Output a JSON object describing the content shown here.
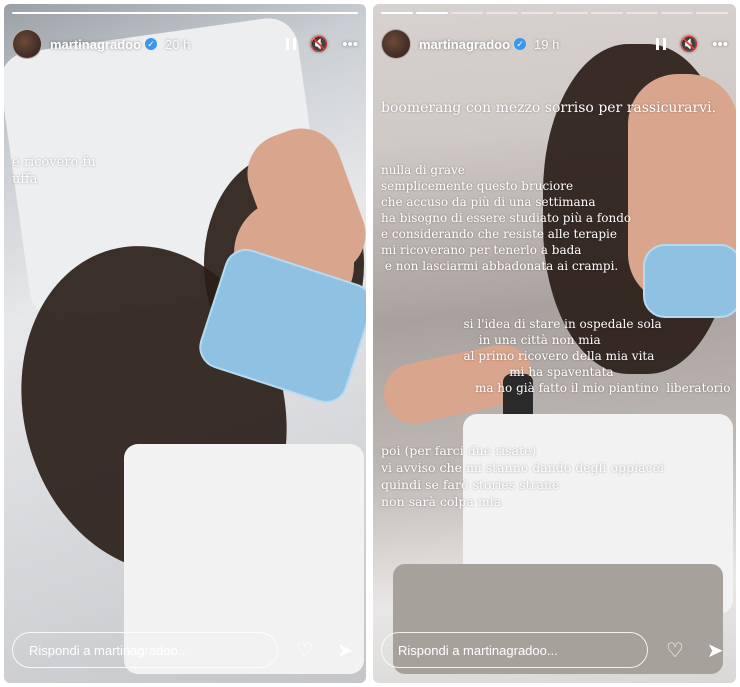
{
  "stories": [
    {
      "username": "martinagradoo",
      "time": "20 h",
      "progress_done": 1,
      "progress_total": 1,
      "caption": "e ricovero fu\nuffa",
      "reply_placeholder": "Rispondi a martinagradoo..."
    },
    {
      "username": "martinagradoo",
      "time": "19 h",
      "progress_done": 2,
      "progress_total": 10,
      "caption_title": "boomerang con mezzo sorriso per rassicurarvi.",
      "caption_block1": "nulla di grave\nsemplicemente questo bruciore\nche accuso da più di una settimana\nha bisogno di essere studiato più a fondo\ne considerando che resiste alle terapie\nmi ricoverano per tenerlo a bada\n e non lasciarmi abbadonata ai crampi.",
      "caption_block2": "        si l'idea di stare in ospedale sola\n            in una città non mia\n        al primo ricovero della mia vita\n                    mi ha spaventata\n           ma ho già fatto il mio piantino  liberatorio",
      "caption_block3": "poi (per farci due risate)\nvi avviso che mi stanno dando degli oppiacei\nquindi se farò stories strane\nnon sarà colpa mia",
      "reply_placeholder": "Rispondi a martinagradoo..."
    }
  ],
  "icons": {
    "pause": "pause-icon",
    "mute": "mute-icon",
    "more": "more-icon",
    "like": "heart-icon",
    "send": "send-icon",
    "verified": "verified-badge-icon"
  },
  "colors": {
    "verified_blue": "#3897f0",
    "mask_blue": "#8fc2e2"
  }
}
